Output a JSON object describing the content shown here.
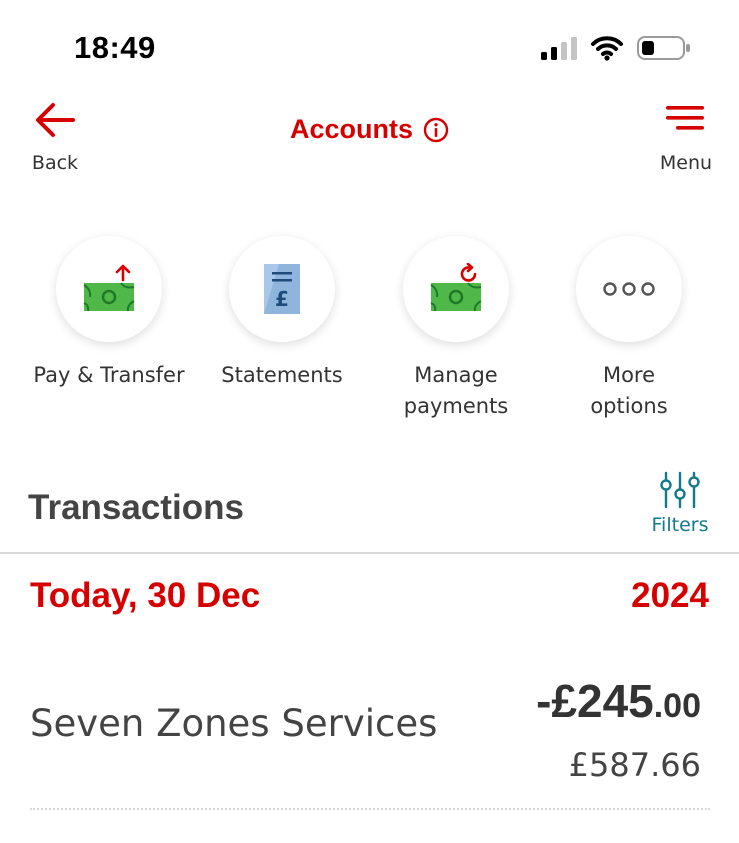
{
  "status_bar": {
    "time": "18:49",
    "icons": [
      "cellular-signal-icon",
      "wifi-icon",
      "battery-icon"
    ]
  },
  "header": {
    "back_label": "Back",
    "title": "Accounts",
    "menu_label": "Menu",
    "accent_color": "#d70000"
  },
  "actions": [
    {
      "label": "Pay & Transfer",
      "icon": "pay-transfer-icon"
    },
    {
      "label": "Statements",
      "icon": "statements-icon"
    },
    {
      "label_line1": "Manage",
      "label_line2": "payments",
      "icon": "manage-payments-icon"
    },
    {
      "label_line1": "More",
      "label_line2": "options",
      "icon": "more-options-icon"
    }
  ],
  "transactions": {
    "title": "Transactions",
    "filters_label": "Filters",
    "date_label": "Today, 30 Dec",
    "year": "2024",
    "items": [
      {
        "merchant": "Seven Zones Services",
        "amount_main": "-£245",
        "amount_decimal": ".00",
        "balance": "£587.66"
      }
    ]
  }
}
